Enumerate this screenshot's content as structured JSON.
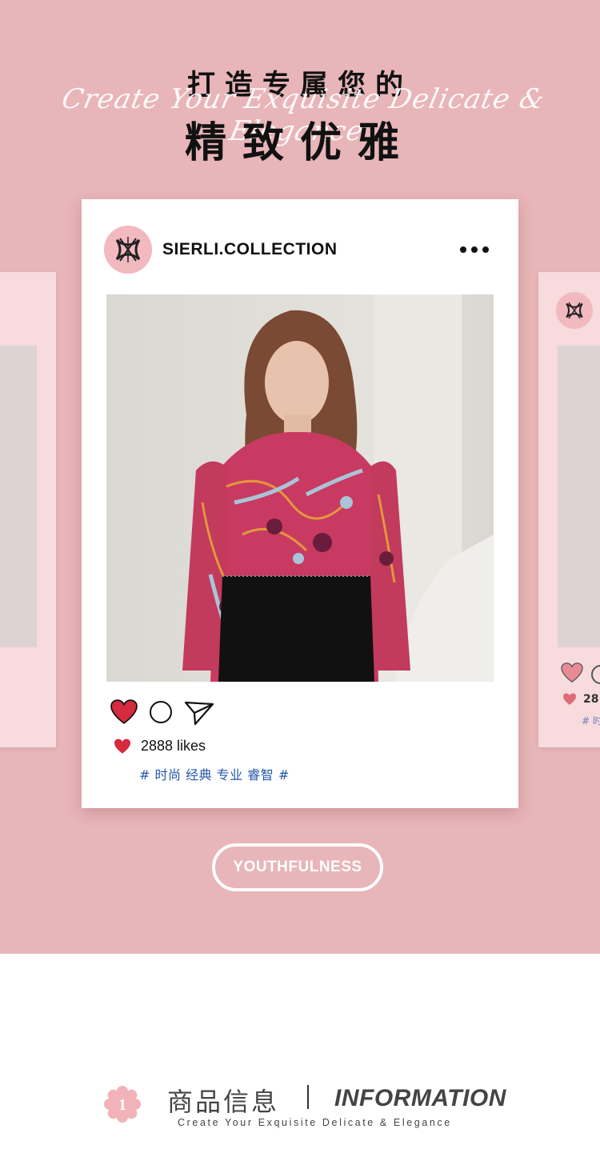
{
  "hero": {
    "title_top": "打造专属您的",
    "script_line": "Create Your Exquisite Delicate & Elegance",
    "title_main": "精致优雅"
  },
  "post": {
    "brand": "SIERLI.COLLECTION",
    "likes": "2888 likes",
    "tags": "# 时尚 经典 专业 睿智 #"
  },
  "ghost_right": {
    "likes_partial": "28",
    "tags_partial": "# 时"
  },
  "pill": {
    "label": "YOUTHFULNESS"
  },
  "footer": {
    "badge_number": "1",
    "title_cn": "商品信息",
    "title_en": "INFORMATION",
    "subtitle": "Create Your Exquisite Delicate & Elegance"
  },
  "colors": {
    "background_pink": "#e8b5b8",
    "heart_red": "#d62a3f",
    "tag_blue": "#2457a8"
  }
}
